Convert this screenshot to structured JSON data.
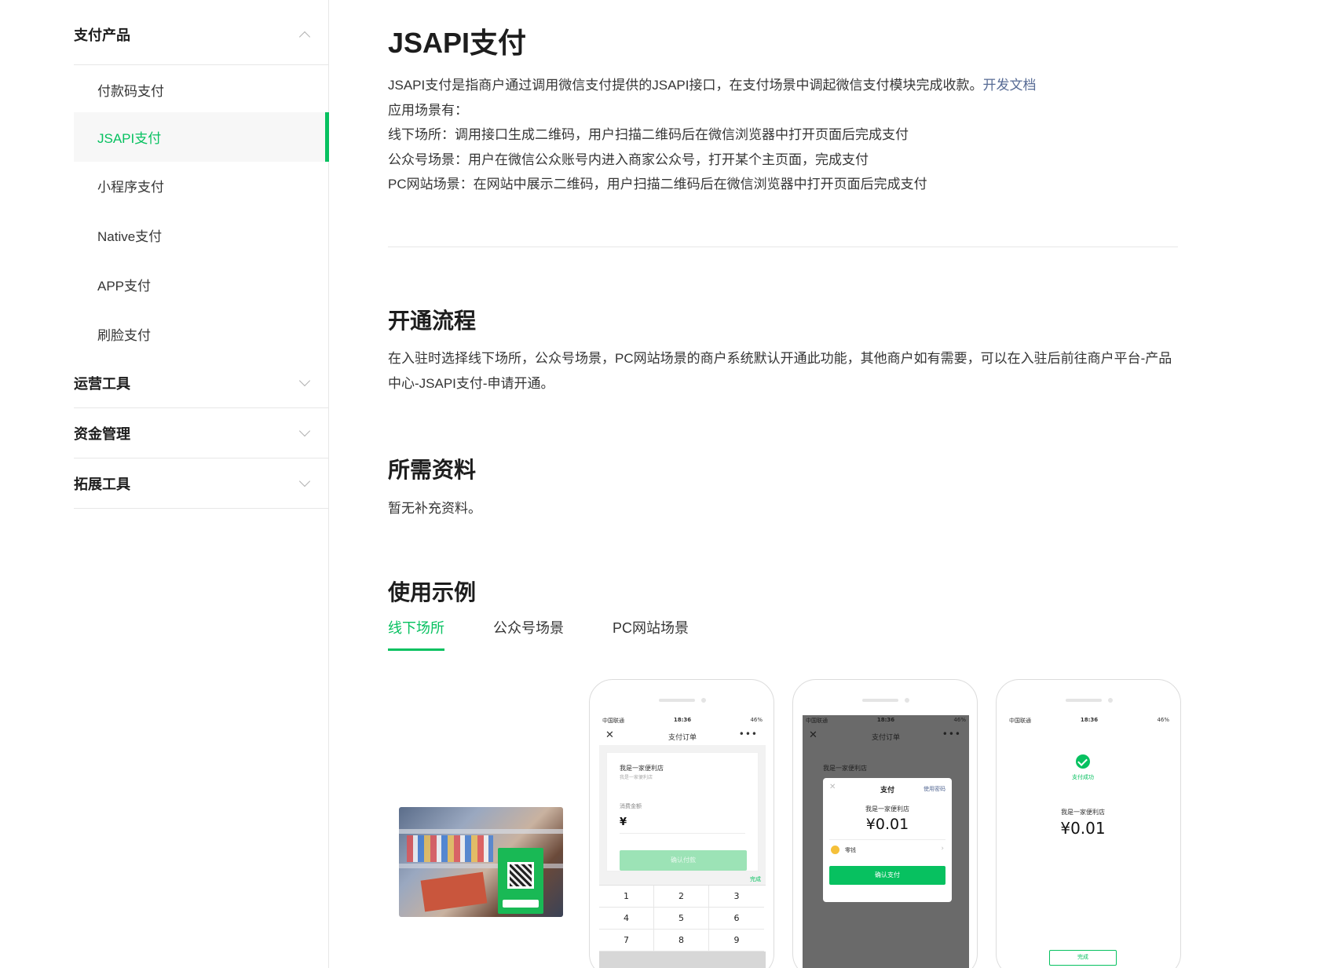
{
  "sidebar": {
    "groups": [
      {
        "label": "支付产品",
        "expanded": true
      },
      {
        "label": "运营工具",
        "expanded": false
      },
      {
        "label": "资金管理",
        "expanded": false
      },
      {
        "label": "拓展工具",
        "expanded": false
      }
    ],
    "items": [
      {
        "label": "付款码支付",
        "active": false
      },
      {
        "label": "JSAPI支付",
        "active": true
      },
      {
        "label": "小程序支付",
        "active": false
      },
      {
        "label": "Native支付",
        "active": false
      },
      {
        "label": "APP支付",
        "active": false
      },
      {
        "label": "刷脸支付",
        "active": false
      }
    ]
  },
  "main": {
    "title": "JSAPI支付",
    "intro": "JSAPI支付是指商户通过调用微信支付提供的JSAPI接口，在支付场景中调起微信支付模块完成收款。",
    "intro_link": "开发文档",
    "scenes_label": "应用场景有：",
    "scenes": [
      "线下场所：调用接口生成二维码，用户扫描二维码后在微信浏览器中打开页面后完成支付",
      "公众号场景：用户在微信公众账号内进入商家公众号，打开某个主页面，完成支付",
      "PC网站场景：在网站中展示二维码，用户扫描二维码后在微信浏览器中打开页面后完成支付"
    ],
    "section_process": {
      "title": "开通流程",
      "text": "在入驻时选择线下场所，公众号场景，PC网站场景的商户系统默认开通此功能，其他商户如有需要，可以在入驻后前往商户平台-产品中心-JSAPI支付-申请开通。"
    },
    "section_materials": {
      "title": "所需资料",
      "text": "暂无补充资料。"
    },
    "section_examples": {
      "title": "使用示例",
      "tabs": [
        {
          "label": "线下场所",
          "active": true
        },
        {
          "label": "公众号场景",
          "active": false
        },
        {
          "label": "PC网站场景",
          "active": false
        }
      ]
    }
  },
  "phones": {
    "status": {
      "carrier": "中国联通",
      "time": "18:36",
      "battery": "46%"
    },
    "order_title": "支付订单",
    "shop": "我是一家便利店",
    "shop_sub": "我是一家便利店",
    "amount_label": "消费金额",
    "yen": "¥",
    "confirm_pay_disabled": "确认付款",
    "done_link": "完成",
    "keys": [
      "1",
      "2",
      "3",
      "4",
      "5",
      "6",
      "7",
      "8",
      "9"
    ],
    "modal_title": "支付",
    "modal_password": "使用密码",
    "modal_amount": "¥0.01",
    "modal_change": "零钱",
    "modal_confirm": "确认支付",
    "success_text": "支付成功",
    "success_amount": "¥0.01",
    "done_button": "完成"
  },
  "colors": {
    "accent": "#07c160",
    "link": "#576b95",
    "text": "#353535"
  }
}
